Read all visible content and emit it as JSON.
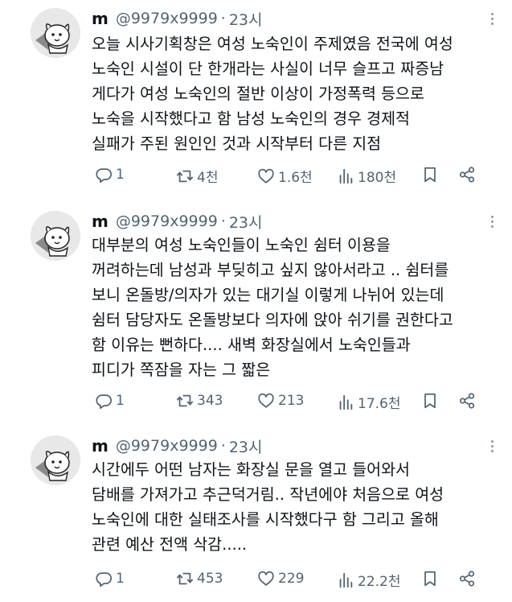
{
  "tweets": [
    {
      "name": "m",
      "handle": "@9979x9999",
      "sep": "·",
      "time": "23시",
      "lines": [
        "오늘 시사기획창은 여성 노숙인이 주제였음 전국에 여성",
        "노숙인 시설이 단 한개라는 사실이 너무 슬프고 짜증남",
        "게다가 여성 노숙인의 절반 이상이 가정폭력 등으로",
        "노숙을 시작했다고 함 남성 노숙인의 경우 경제적",
        "실패가 주된 원인인 것과 시작부터 다른 지점"
      ],
      "replies": "1",
      "retweets": "4천",
      "likes": "1.6천",
      "views": "180천"
    },
    {
      "name": "m",
      "handle": "@9979x9999",
      "sep": "·",
      "time": "23시",
      "lines": [
        "대부분의 여성 노숙인들이 노숙인 쉼터 이용을",
        "꺼려하는데 남성과 부딪히고 싶지 않아서라고 .. 쉼터를",
        "보니 온돌방/의자가 있는 대기실 이렇게 나뉘어 있는데",
        "쉼터 담당자도 온돌방보다 의자에 앉아 쉬기를 권한다고",
        "함 이유는 뻔하다.... 새벽 화장실에서 노숙인들과",
        "피디가 쪽잠을 자는 그 짧은"
      ],
      "replies": "1",
      "retweets": "343",
      "likes": "213",
      "views": "17.6천"
    },
    {
      "name": "m",
      "handle": "@9979x9999",
      "sep": "·",
      "time": "23시",
      "lines": [
        "시간에두 어떤 남자는 화장실 문을 열고 들어와서",
        "담배를 가져가고 추근덕거림.. 작년에야 처음으로 여성",
        "노숙인에 대한 실태조사를 시작했다구 함 그리고 올해",
        "관련 예산 전액 삭감....."
      ],
      "replies": "1",
      "retweets": "453",
      "likes": "229",
      "views": "22.2천"
    }
  ],
  "icons": {
    "avatar": "cartoon-dog-avatar",
    "more": "more-dots-icon",
    "reply": "reply-icon",
    "retweet": "retweet-icon",
    "like": "heart-icon",
    "views": "views-chart-icon",
    "bookmark": "bookmark-icon",
    "share": "share-icon"
  },
  "colors": {
    "text": "#0f1419",
    "muted": "#536471"
  }
}
